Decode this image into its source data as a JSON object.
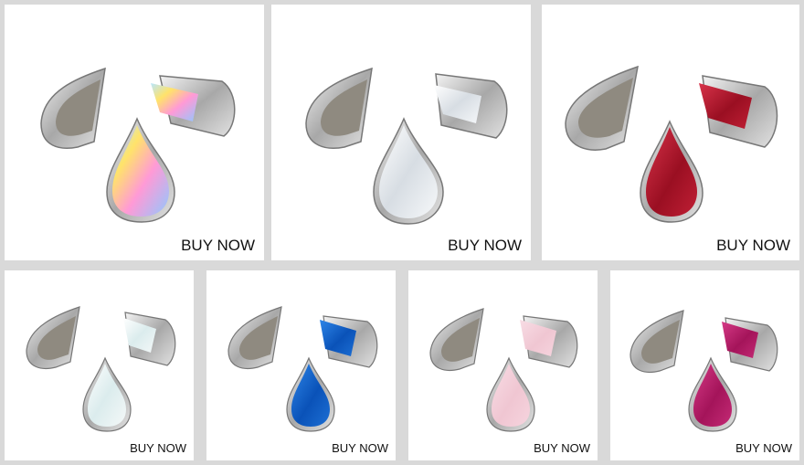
{
  "products": [
    {
      "button": "BUY NOW",
      "stone": "ab-crystal",
      "color": "#e8e0ff",
      "accent": "#f6d86a"
    },
    {
      "button": "BUY NOW",
      "stone": "crystal-clear",
      "color": "#eef2f6",
      "accent": "#c8d0d8"
    },
    {
      "button": "BUY NOW",
      "stone": "siam-red",
      "color": "#9a0f22",
      "accent": "#d8334a"
    },
    {
      "button": "BUY NOW",
      "stone": "white-opal",
      "color": "#eef3f3",
      "accent": "#cfe3e6"
    },
    {
      "button": "BUY NOW",
      "stone": "capri-blue",
      "color": "#0a52b8",
      "accent": "#2e86e8"
    },
    {
      "button": "BUY NOW",
      "stone": "rose-water-opal",
      "color": "#f0c6d2",
      "accent": "#f8dde5"
    },
    {
      "button": "BUY NOW",
      "stone": "fuchsia",
      "color": "#a4145a",
      "accent": "#d53a86"
    }
  ]
}
